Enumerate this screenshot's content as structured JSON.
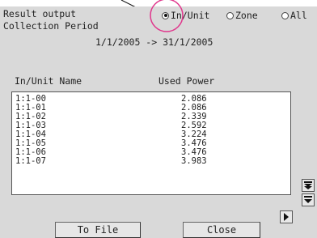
{
  "header": {
    "result_output_label": "Result output",
    "collection_period_label": "Collection Period",
    "period_range": "1/1/2005 -> 31/1/2005"
  },
  "result_options": [
    {
      "label": "In/Unit",
      "selected": true
    },
    {
      "label": "Zone",
      "selected": false
    },
    {
      "label": "All",
      "selected": false
    }
  ],
  "table": {
    "columns": [
      "In/Unit Name",
      "Used Power"
    ],
    "rows": [
      {
        "name": "1:1-00",
        "power": "2.086"
      },
      {
        "name": "1:1-01",
        "power": "2.086"
      },
      {
        "name": "1:1-02",
        "power": "2.339"
      },
      {
        "name": "1:1-03",
        "power": "2.592"
      },
      {
        "name": "1:1-04",
        "power": "3.224"
      },
      {
        "name": "1:1-05",
        "power": "3.476"
      },
      {
        "name": "1:1-06",
        "power": "3.476"
      },
      {
        "name": "1:1-07",
        "power": "3.983"
      }
    ]
  },
  "buttons": {
    "to_file": "To File",
    "close": "Close"
  },
  "icons": {
    "scroll_down_page": "double-down-arrow-icon",
    "scroll_down": "down-arrow-icon",
    "next_page": "right-arrow-icon"
  },
  "colors": {
    "highlight_circle": "#e0368c",
    "panel_bg": "#d9d9d9"
  }
}
